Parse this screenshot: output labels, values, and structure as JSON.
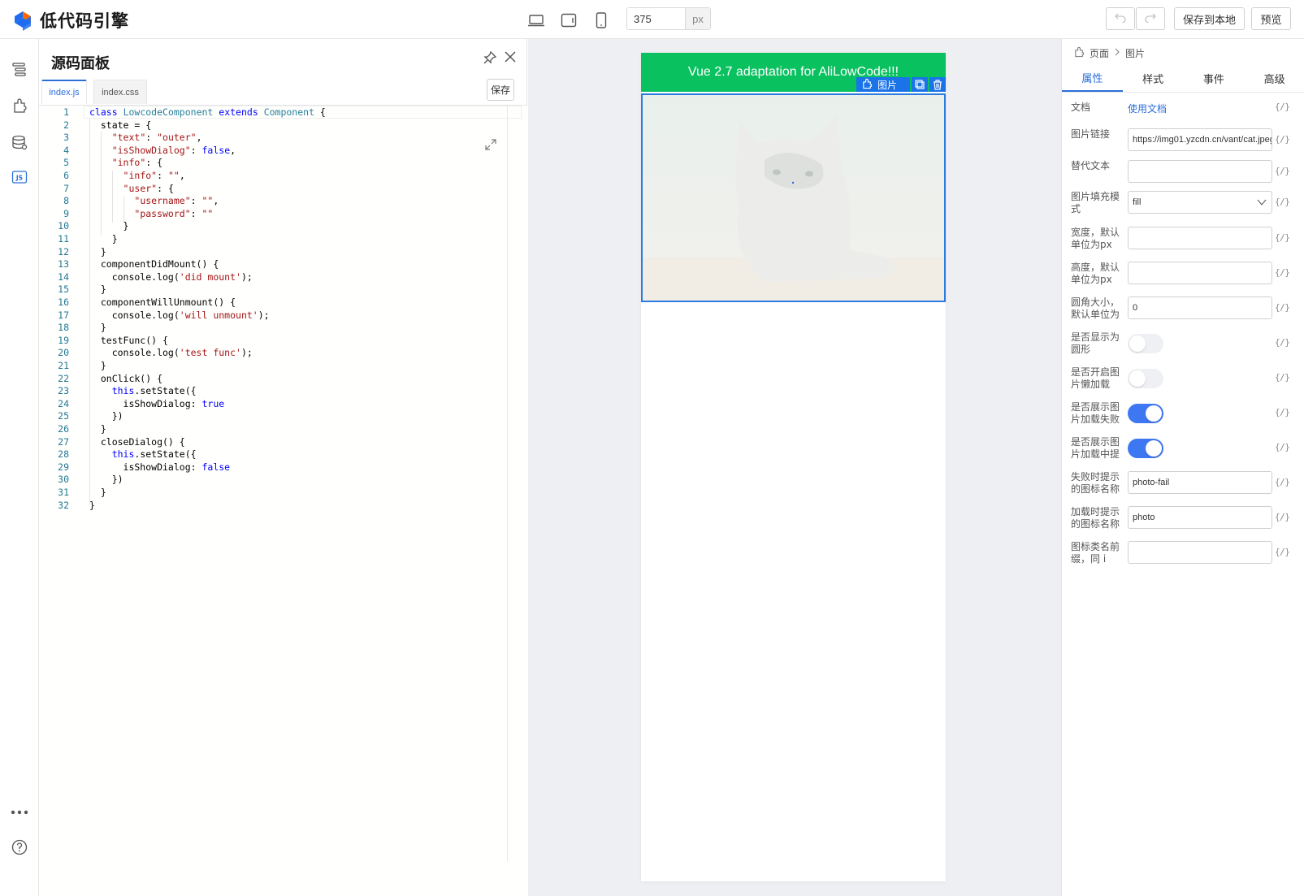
{
  "app": {
    "title": "低代码引擎"
  },
  "toolbar": {
    "width_value": "375",
    "width_unit": "px",
    "save_label": "保存到本地",
    "preview_label": "预览",
    "device_icons": [
      "desktop-icon",
      "tablet-icon",
      "phone-icon"
    ]
  },
  "leftnav": {
    "icons": [
      "outline-icon",
      "component-icon",
      "datasource-icon",
      "js-icon",
      "more-icon",
      "help-icon"
    ],
    "js_label": "JS"
  },
  "code_panel": {
    "title": "源码面板",
    "tabs": [
      "index.js",
      "index.css"
    ],
    "save_label": "保存",
    "lines": [
      "class LowcodeComponent extends Component {",
      "  state = {",
      "    \"text\": \"outer\",",
      "    \"isShowDialog\": false,",
      "    \"info\": {",
      "      \"info\": \"\",",
      "      \"user\": {",
      "        \"username\": \"\",",
      "        \"password\": \"\"",
      "      }",
      "    }",
      "  }",
      "  componentDidMount() {",
      "    console.log('did mount');",
      "  }",
      "  componentWillUnmount() {",
      "    console.log('will unmount');",
      "  }",
      "  testFunc() {",
      "    console.log('test func');",
      "  }",
      "  onClick() {",
      "    this.setState({",
      "      isShowDialog: true",
      "    })",
      "  }",
      "  closeDialog() {",
      "    this.setState({",
      "      isShowDialog: false",
      "    })",
      "  }",
      "}"
    ]
  },
  "canvas": {
    "banner_text": "Vue 2.7 adaptation for AliLowCode!!!",
    "selected_label": "图片",
    "banner_color": "#0ac160",
    "selection_color": "#1a73e8"
  },
  "props_panel": {
    "breadcrumb": [
      "页面",
      "图片"
    ],
    "tabs": [
      "属性",
      "样式",
      "事件",
      "高级"
    ],
    "bind_label": "{/}",
    "rows": [
      {
        "label": "文档",
        "type": "link",
        "value": "使用文档"
      },
      {
        "label": "图片链接",
        "type": "input",
        "value": "https://img01.yzcdn.cn/vant/cat.jpeg"
      },
      {
        "label": "替代文本",
        "type": "input",
        "value": ""
      },
      {
        "label": "图片填充模式",
        "type": "select",
        "value": "fill"
      },
      {
        "label": "宽度，默认单位为px",
        "type": "input",
        "value": ""
      },
      {
        "label": "高度，默认单位为px",
        "type": "input",
        "value": ""
      },
      {
        "label": "圆角大小，默认单位为",
        "type": "input",
        "value": "0"
      },
      {
        "label": "是否显示为圆形",
        "type": "toggle",
        "checked": false
      },
      {
        "label": "是否开启图片懒加载",
        "type": "toggle",
        "checked": false
      },
      {
        "label": "是否展示图片加载失败",
        "type": "toggle",
        "checked": true
      },
      {
        "label": "是否展示图片加载中提",
        "type": "toggle",
        "checked": true
      },
      {
        "label": "失败时提示的图标名称",
        "type": "input",
        "value": "photo-fail"
      },
      {
        "label": "加载时提示的图标名称",
        "type": "input",
        "value": "photo"
      },
      {
        "label": "图标类名前缀，同 i",
        "type": "input",
        "value": ""
      }
    ]
  },
  "colors": {
    "accent": "#2b6fd8",
    "toggle_on": "#3e77f2"
  }
}
